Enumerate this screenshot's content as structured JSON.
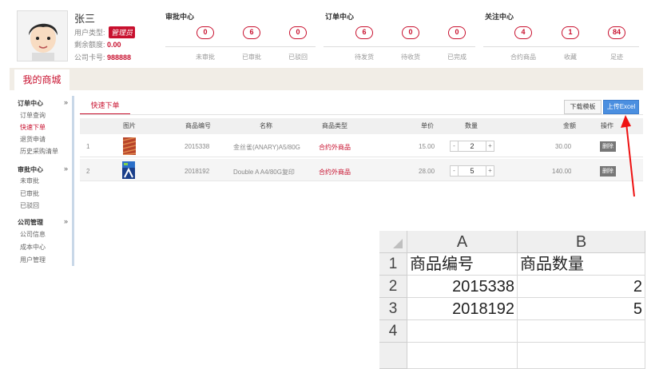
{
  "profile": {
    "name": "张三",
    "user_type_label": "用户类型:",
    "user_type_value": "管理员",
    "quota_label": "剩余额度:",
    "quota_value": "0.00",
    "company_card_label": "公司卡号:",
    "company_card_value": "988888"
  },
  "stats": {
    "groups": [
      {
        "title": "审批中心"
      },
      {
        "title": "订单中心"
      },
      {
        "title": "关注中心"
      }
    ],
    "items": [
      {
        "value": "0",
        "label": "未审批"
      },
      {
        "value": "6",
        "label": "已审批"
      },
      {
        "value": "0",
        "label": "已驳回"
      },
      {
        "value": "6",
        "label": "待发货"
      },
      {
        "value": "0",
        "label": "待收货"
      },
      {
        "value": "0",
        "label": "已完成"
      },
      {
        "value": "4",
        "label": "合约商品"
      },
      {
        "value": "1",
        "label": "收藏"
      },
      {
        "value": "84",
        "label": "足迹"
      }
    ]
  },
  "mall_tab": "我的商城",
  "sidebar": {
    "groups": [
      {
        "title": "订单中心",
        "items": [
          "订单查询",
          "快速下单",
          "退货申请",
          "历史采购清单"
        ]
      },
      {
        "title": "审批中心",
        "items": [
          "未审批",
          "已审批",
          "已驳回"
        ]
      },
      {
        "title": "公司管理",
        "items": [
          "公司信息",
          "成本中心",
          "用户管理"
        ]
      }
    ]
  },
  "main": {
    "tab": "快速下单",
    "download_button": "下载模板",
    "upload_button": "上传Excel",
    "columns": [
      "图片",
      "商品编号",
      "名称",
      "商品类型",
      "单价",
      "数量",
      "金额",
      "操作"
    ],
    "rows": [
      {
        "index": "1",
        "code": "2015338",
        "name": "金丝雀(ANARY)A5/80G",
        "type": "合约外商品",
        "price": "15.00",
        "qty": "2",
        "amount": "30.00",
        "action": "删除"
      },
      {
        "index": "2",
        "code": "2018192",
        "name": "Double A A4/80G复印",
        "type": "合约外商品",
        "price": "28.00",
        "qty": "5",
        "amount": "140.00",
        "action": "删除"
      }
    ]
  },
  "excel": {
    "col_headers": [
      "A",
      "B"
    ],
    "row_headers": [
      "1",
      "2",
      "3",
      "4"
    ],
    "rows": [
      [
        "商品编号",
        "商品数量"
      ],
      [
        "2015338",
        "2"
      ],
      [
        "2018192",
        "5"
      ],
      [
        "",
        ""
      ]
    ]
  },
  "colors": {
    "accent_red": "#c8102e",
    "upload_blue": "#4b8fe0",
    "mall_bar": "#f1ede6"
  }
}
